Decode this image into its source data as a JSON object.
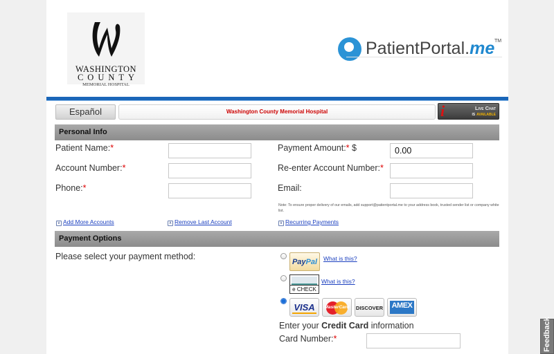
{
  "header": {
    "hospital_logo": {
      "line1": "WASHINGTON",
      "line2": "COUNTY",
      "line3": "MEMORIAL HOSPITAL"
    },
    "portal_logo": {
      "name_main": "PatientPortal.",
      "name_suffix": "me",
      "trademark": "TM"
    },
    "accent_color": "#1a66b8"
  },
  "top_bar": {
    "language_button": "Español",
    "hospital_name": "Washington County Memorial Hospital",
    "live_chat_line1": "Live Chat",
    "live_chat_line2_prefix": "is",
    "live_chat_line2_status": "available",
    "live_chat_icon": "info-icon"
  },
  "personal_info": {
    "title": "Personal Info",
    "patient_name_label": "Patient Name:",
    "account_number_label": "Account Number:",
    "phone_label": "Phone:",
    "payment_amount_label": "Payment Amount:",
    "currency_symbol": "$",
    "payment_amount_value": "0.00",
    "reenter_account_label": "Re-enter Account Number:",
    "email_label": "Email:",
    "required_marker": "*",
    "email_note": "Note: To ensure proper delivery of our emails, add support@patientportal.me to your address book, trusted sender list or company white list.",
    "add_more_accounts": "Add More Accounts",
    "remove_last_account": "Remove Last Account",
    "recurring_payments": "Recurring Payments"
  },
  "payment_options": {
    "title": "Payment Options",
    "select_prompt": "Please select your payment method:",
    "methods": [
      {
        "name": "PayPal",
        "what_is_this": "What is this?",
        "selected": false
      },
      {
        "name": "e CHECK",
        "what_is_this": "What is this?",
        "selected": false
      },
      {
        "name": "Credit Card",
        "selected": true
      }
    ],
    "paypal_part1": "Pay",
    "paypal_part2": "Pal",
    "echeck_label": "e CHECK",
    "card_brands": [
      "VISA",
      "MasterCard",
      "DISCOVER",
      "AMEX"
    ],
    "enter_prefix": "Enter your ",
    "enter_bold": "Credit Card",
    "enter_suffix": " information",
    "card_number_label": "Card Number:"
  },
  "feedback_tab": "Feedback"
}
